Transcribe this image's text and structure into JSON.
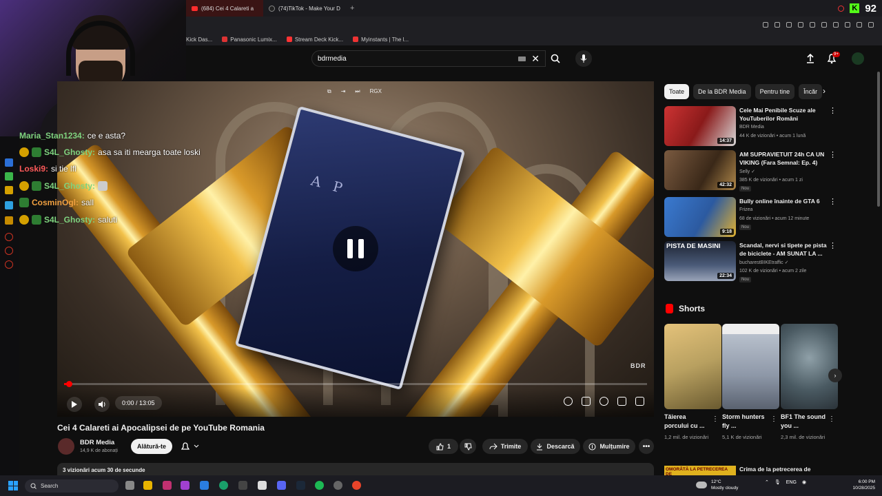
{
  "browser": {
    "tabs": [
      {
        "label": "(684) Cei 4 Calareti a",
        "active": true
      },
      {
        "label": "(74)TikTok - Make Your D",
        "active": false
      }
    ],
    "new_tab": "+",
    "kick_badge": "K",
    "kick_count": "92",
    "bookmarks": [
      {
        "label": "Kick Das...",
        "color": "#53fc18"
      },
      {
        "label": "Panasonic Lumix...",
        "color": "#d33"
      },
      {
        "label": "Stream Deck Kick...",
        "color": "#f33"
      },
      {
        "label": "Myinstants | The l...",
        "color": "#e33"
      }
    ]
  },
  "youtube": {
    "search": {
      "value": "bdrmedia"
    },
    "notifications_badge": "9+",
    "video": {
      "title": "Cei 4 Calareti ai Apocalipsei de pe YouTube Romania",
      "time": "0:00 / 13:05",
      "progress": 0.008,
      "watermark": "BDR",
      "book_text": "A P",
      "top_controls": [
        "⧉",
        "⇥",
        "⏭",
        "RGX"
      ]
    },
    "channel": {
      "name": "BDR Media",
      "subscribers": "14,9 K de abonați",
      "join_label": "Alătură-te"
    },
    "actions": {
      "likes": "1",
      "share": "Trimite",
      "download": "Descarcă",
      "thanks": "Mulțumire"
    },
    "description": "3 vizionări  acum 30 de secunde",
    "chips": [
      "Toate",
      "De la BDR Media",
      "Pentru tine",
      "Încăr"
    ],
    "recommended": [
      {
        "title": "Cele Mai Penibile Scuze ale YouTuberilor Români",
        "channel": "BDR Media",
        "meta": "44 K de vizionări • acum 1 lună",
        "duration": "14:37",
        "badge": "",
        "color": "#8a1a1a"
      },
      {
        "title": "AM SUPRAVIETUIT 24h CA UN VIKING (Fara Semnal: Ep. 4)",
        "channel": "Selly ✓",
        "meta": "385 K de vizionări • acum 1 zi",
        "duration": "42:32",
        "badge": "Nou",
        "color": "#5a4030"
      },
      {
        "title": "Bully online înainte de GTA 6",
        "channel": "Frizea",
        "meta": "68 de vizionări • acum 12 minute",
        "duration": "9:18",
        "badge": "Nou",
        "color": "#2c5aa0"
      },
      {
        "title": "Scandal, nervi si tipete pe pista de biciclete - AM SUNAT LA ...",
        "channel": "bucharestBIKEtraffic ✓",
        "meta": "102 K de vizionări • acum 2 zile",
        "duration": "22:34",
        "badge": "Nou",
        "color": "#303848",
        "overlay": "PISTA DE MASINI"
      }
    ],
    "shorts_heading": "Shorts",
    "shorts": [
      {
        "title": "Tăierea porcului cu ...",
        "views": "1,2 mil. de vizionări",
        "color": "#b8a060"
      },
      {
        "title": "Storm hunters fly ...",
        "views": "5,1 K de vizionări",
        "color": "#8e98a8"
      },
      {
        "title": "BF1 The sound you ...",
        "views": "2,3 mil. de vizionări",
        "color": "#4a5a62"
      }
    ],
    "last_item": {
      "thumb": "OMORÂTĂ LA PETRECEREA DE",
      "title": "Crima de la petrecerea de"
    }
  },
  "chat": [
    {
      "user": "Maria_Stan1234:",
      "msg": "ce e asta?",
      "color": "#7fd37f"
    },
    {
      "user": "S4L_Ghosty:",
      "msg": "asa sa iti mearga toate loski",
      "color": "#7fd37f"
    },
    {
      "user": "Loski9:",
      "msg": "si tie lfl",
      "color": "#ff5a5a"
    },
    {
      "user": "S4L_Ghosty:",
      "msg": "",
      "color": "#7fd37f"
    },
    {
      "user": "CosminOgl:",
      "msg": "sall",
      "color": "#f0a040"
    },
    {
      "user": "S4L_Ghosty:",
      "msg": "saluti",
      "color": "#7fd37f"
    }
  ],
  "taskbar": {
    "search_label": "Search",
    "weather_temp": "12°C",
    "weather_desc": "Mostly cloudy",
    "lang": "ENG",
    "time": "6:00 PM",
    "date": "10/28/2025"
  }
}
